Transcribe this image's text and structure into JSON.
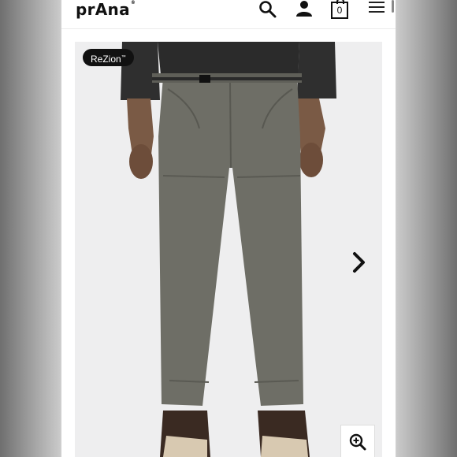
{
  "header": {
    "brand": "prAna",
    "brand_mark": "®",
    "cart_count": "0",
    "icons": [
      "search-icon",
      "account-icon",
      "cart-icon",
      "menu-icon"
    ]
  },
  "product": {
    "badge": "ReZion",
    "badge_mark": "™",
    "image_subject": "grey pants",
    "controls": [
      "next-arrow-icon",
      "zoom-icon"
    ]
  },
  "colors": {
    "accent": "#111111",
    "background": "#ffffff",
    "pants": "#6e6e66"
  }
}
